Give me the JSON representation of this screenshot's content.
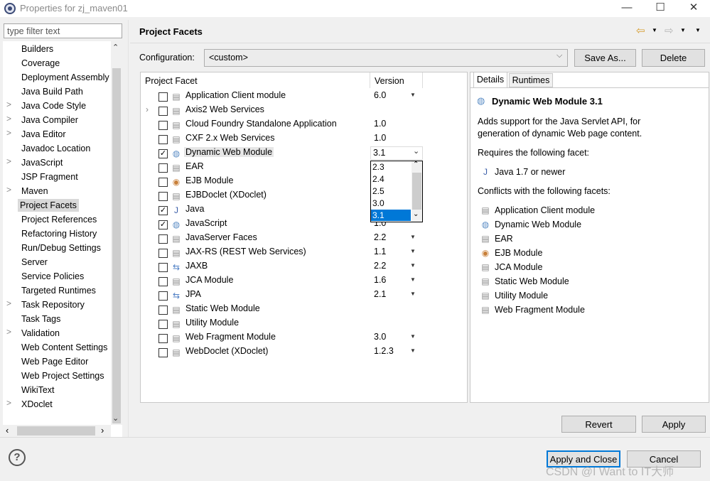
{
  "window": {
    "title": "Properties for zj_maven01",
    "min": "—",
    "max": "☐",
    "close": "✕"
  },
  "filter": {
    "placeholder": "type filter text"
  },
  "tree": {
    "items": [
      {
        "label": "Builders",
        "arrow": ""
      },
      {
        "label": "Coverage",
        "arrow": ""
      },
      {
        "label": "Deployment Assembly",
        "arrow": ""
      },
      {
        "label": "Java Build Path",
        "arrow": ""
      },
      {
        "label": "Java Code Style",
        "arrow": ">"
      },
      {
        "label": "Java Compiler",
        "arrow": ">"
      },
      {
        "label": "Java Editor",
        "arrow": ">"
      },
      {
        "label": "Javadoc Location",
        "arrow": ""
      },
      {
        "label": "JavaScript",
        "arrow": ">"
      },
      {
        "label": "JSP Fragment",
        "arrow": ""
      },
      {
        "label": "Maven",
        "arrow": ">"
      },
      {
        "label": "Project Facets",
        "arrow": "",
        "selected": true
      },
      {
        "label": "Project References",
        "arrow": ""
      },
      {
        "label": "Refactoring History",
        "arrow": ""
      },
      {
        "label": "Run/Debug Settings",
        "arrow": ""
      },
      {
        "label": "Server",
        "arrow": ""
      },
      {
        "label": "Service Policies",
        "arrow": ""
      },
      {
        "label": "Targeted Runtimes",
        "arrow": ""
      },
      {
        "label": "Task Repository",
        "arrow": ">"
      },
      {
        "label": "Task Tags",
        "arrow": ""
      },
      {
        "label": "Validation",
        "arrow": ">"
      },
      {
        "label": "Web Content Settings",
        "arrow": ""
      },
      {
        "label": "Web Page Editor",
        "arrow": ""
      },
      {
        "label": "Web Project Settings",
        "arrow": ""
      },
      {
        "label": "WikiText",
        "arrow": ""
      },
      {
        "label": "XDoclet",
        "arrow": ">"
      }
    ]
  },
  "page": {
    "title": "Project Facets"
  },
  "config": {
    "label": "Configuration:",
    "value": "<custom>",
    "save_as": "Save As...",
    "delete": "Delete"
  },
  "table": {
    "col_facet": "Project Facet",
    "col_version": "Version",
    "rows": [
      {
        "name": "Application Client module",
        "version": "6.0",
        "checked": false,
        "drop": true,
        "icon": "page",
        "expand": false
      },
      {
        "name": "Axis2 Web Services",
        "version": "",
        "checked": false,
        "drop": false,
        "icon": "page",
        "expand": true
      },
      {
        "name": "Cloud Foundry Standalone Application",
        "version": "1.0",
        "checked": false,
        "drop": false,
        "icon": "page",
        "expand": false
      },
      {
        "name": "CXF 2.x Web Services",
        "version": "1.0",
        "checked": false,
        "drop": false,
        "icon": "page",
        "expand": false
      },
      {
        "name": "Dynamic Web Module",
        "version": "",
        "checked": true,
        "drop": false,
        "icon": "globe",
        "expand": false,
        "highlight": true
      },
      {
        "name": "EAR",
        "version": "",
        "checked": false,
        "drop": false,
        "icon": "page",
        "expand": false
      },
      {
        "name": "EJB Module",
        "version": "",
        "checked": false,
        "drop": false,
        "icon": "bean",
        "expand": false
      },
      {
        "name": "EJBDoclet (XDoclet)",
        "version": "",
        "checked": false,
        "drop": false,
        "icon": "page",
        "expand": false
      },
      {
        "name": "Java",
        "version": "",
        "checked": true,
        "drop": false,
        "icon": "java",
        "expand": false
      },
      {
        "name": "JavaScript",
        "version": "1.0",
        "checked": true,
        "drop": false,
        "icon": "globe",
        "expand": false
      },
      {
        "name": "JavaServer Faces",
        "version": "2.2",
        "checked": false,
        "drop": true,
        "icon": "page",
        "expand": false
      },
      {
        "name": "JAX-RS (REST Web Services)",
        "version": "1.1",
        "checked": false,
        "drop": true,
        "icon": "page",
        "expand": false
      },
      {
        "name": "JAXB",
        "version": "2.2",
        "checked": false,
        "drop": true,
        "icon": "arrows",
        "expand": false
      },
      {
        "name": "JCA Module",
        "version": "1.6",
        "checked": false,
        "drop": true,
        "icon": "page",
        "expand": false
      },
      {
        "name": "JPA",
        "version": "2.1",
        "checked": false,
        "drop": true,
        "icon": "arrows",
        "expand": false
      },
      {
        "name": "Static Web Module",
        "version": "",
        "checked": false,
        "drop": false,
        "icon": "page",
        "expand": false
      },
      {
        "name": "Utility Module",
        "version": "",
        "checked": false,
        "drop": false,
        "icon": "page",
        "expand": false
      },
      {
        "name": "Web Fragment Module",
        "version": "3.0",
        "checked": false,
        "drop": true,
        "icon": "page",
        "expand": false
      },
      {
        "name": "WebDoclet (XDoclet)",
        "version": "1.2.3",
        "checked": false,
        "drop": true,
        "icon": "page",
        "expand": false
      }
    ]
  },
  "version_dropdown": {
    "selected": "3.1",
    "options": [
      "2.3",
      "2.4",
      "2.5",
      "3.0",
      "3.1"
    ]
  },
  "details": {
    "tab_details": "Details",
    "tab_runtimes": "Runtimes",
    "title": "Dynamic Web Module 3.1",
    "description_1": "Adds support for the Java Servlet API, for",
    "description_2": "generation of dynamic Web page content.",
    "requires_label": "Requires the following facet:",
    "requires": [
      {
        "name": "Java 1.7 or newer",
        "icon": "java"
      }
    ],
    "conflicts_label": "Conflicts with the following facets:",
    "conflicts": [
      {
        "name": "Application Client module",
        "icon": "page"
      },
      {
        "name": "Dynamic Web Module",
        "icon": "globe"
      },
      {
        "name": "EAR",
        "icon": "page"
      },
      {
        "name": "EJB Module",
        "icon": "bean"
      },
      {
        "name": "JCA Module",
        "icon": "page"
      },
      {
        "name": "Static Web Module",
        "icon": "page"
      },
      {
        "name": "Utility Module",
        "icon": "page"
      },
      {
        "name": "Web Fragment Module",
        "icon": "page"
      }
    ]
  },
  "buttons": {
    "revert": "Revert",
    "apply": "Apply",
    "apply_close": "Apply and Close",
    "cancel": "Cancel"
  },
  "help": "?",
  "watermark": "CSDN @I Want to IT大师"
}
